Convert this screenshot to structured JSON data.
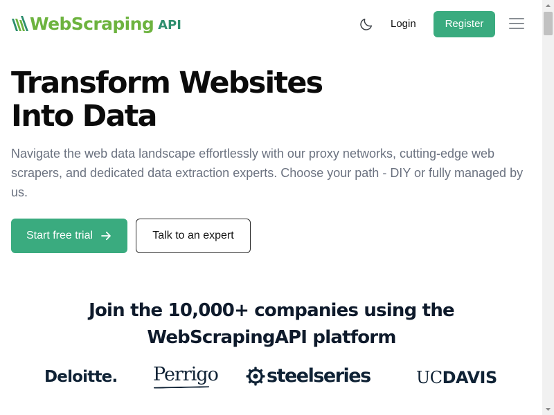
{
  "header": {
    "logo_text": "WebScraping",
    "logo_api": "API",
    "theme_icon": "moon-icon",
    "login_label": "Login",
    "register_label": "Register",
    "menu_icon": "hamburger-menu-icon"
  },
  "hero": {
    "title_line1": "Transform Websites",
    "title_line2": "Into Data",
    "description": "Navigate the web data landscape effortlessly with our proxy networks, cutting-edge web scrapers, and dedicated data extraction experts. Choose your path - DIY or fully managed by us.",
    "cta_primary": "Start free trial",
    "cta_primary_icon": "arrow-right-icon",
    "cta_secondary": "Talk to an expert"
  },
  "social_proof": {
    "heading_line1": "Join the 10,000+ companies using the",
    "heading_line2": "WebScrapingAPI platform",
    "logos": [
      {
        "name": "Deloitte.",
        "icon": "deloitte-logo"
      },
      {
        "name": "Perrigo",
        "icon": "perrigo-logo"
      },
      {
        "name": "steelseries",
        "icon": "steelseries-logo"
      },
      {
        "name_part1": "UC",
        "name_part2": "DAVIS",
        "icon": "ucdavis-logo"
      }
    ]
  },
  "colors": {
    "brand_green": "#3aab7f",
    "logo_green": "#6db33f",
    "heading_dark": "#0b0b0b",
    "body_gray": "#6b7280",
    "logo_navy": "#0f2235"
  }
}
